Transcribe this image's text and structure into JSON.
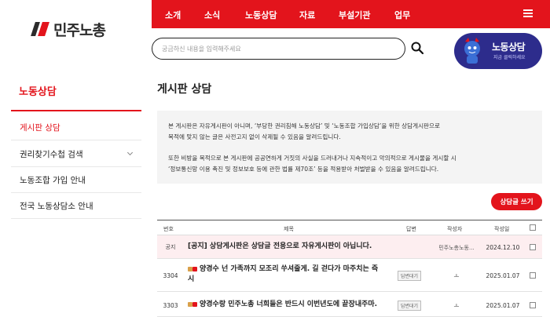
{
  "brand": {
    "logo_text": "민주노총"
  },
  "nav": {
    "items": [
      "소개",
      "소식",
      "노동상담",
      "자료",
      "부설기관",
      "업무"
    ]
  },
  "search": {
    "placeholder": "궁금하신 내용을 입력해주세요"
  },
  "counsel_badge": {
    "title": "노동상담",
    "subtitle": "지금 클릭하세요"
  },
  "sidebar": {
    "title": "노동상담",
    "items": [
      {
        "label": "게시판 상담"
      },
      {
        "label": "권리찾기수첩 검색"
      },
      {
        "label": "노동조합 가입 안내"
      },
      {
        "label": "전국 노동상담소 안내"
      }
    ]
  },
  "main": {
    "title": "게시판 상담",
    "notice": {
      "p1_l1": "본 게시판은 자유게시판이 아니며, ‘부당한 권리침해 노동상담’ 및 ‘노동조합 가입상담’을 위한 상담게시판으로",
      "p1_l2": "목적에 맞지 않는 글은 사전고지 없이 삭제될 수 있음을 알려드립니다.",
      "p2_l1": "또한 비방을 목적으로 본 게시판에 공공연하게 거짓의 사실을 드러내거나 지속적이고 악의적으로 게시물을 게시할 시",
      "p2_l2": "‘정보통신망 이용 촉진 및 정보보호 등에 관한 법률 제70조’ 등을 적용받아 처벌받을 수 있음을 알려드립니다."
    },
    "write_button": "상담글 쓰기",
    "table": {
      "headers": {
        "num": "번호",
        "subject": "제목",
        "reply": "답변",
        "author": "작성자",
        "date": "작성일"
      },
      "rows": [
        {
          "num": "공지",
          "subject": "[공지] 상담게시판은 상담글 전용으로 자유게시판이 아닙니다.",
          "status": "",
          "author": "민주노총노동...",
          "date": "2024.12.10"
        },
        {
          "num": "3304",
          "subject_l1": "양경수 넌 가족까지 모조리 쑤셔줄게. 길 걷다가 마주치는 즉",
          "subject_l2": "시",
          "status": "답변대기",
          "author": "ㅗ",
          "date": "2025.01.07"
        },
        {
          "num": "3303",
          "subject": "양경수랑 민주노총 너희들은 반드시 이번년도에 끝장내주마.",
          "status": "답변대기",
          "author": "ㅗ",
          "date": "2025.01.07"
        }
      ]
    }
  },
  "colors": {
    "accent": "#e3141c",
    "badge": "#2d2c8c"
  }
}
